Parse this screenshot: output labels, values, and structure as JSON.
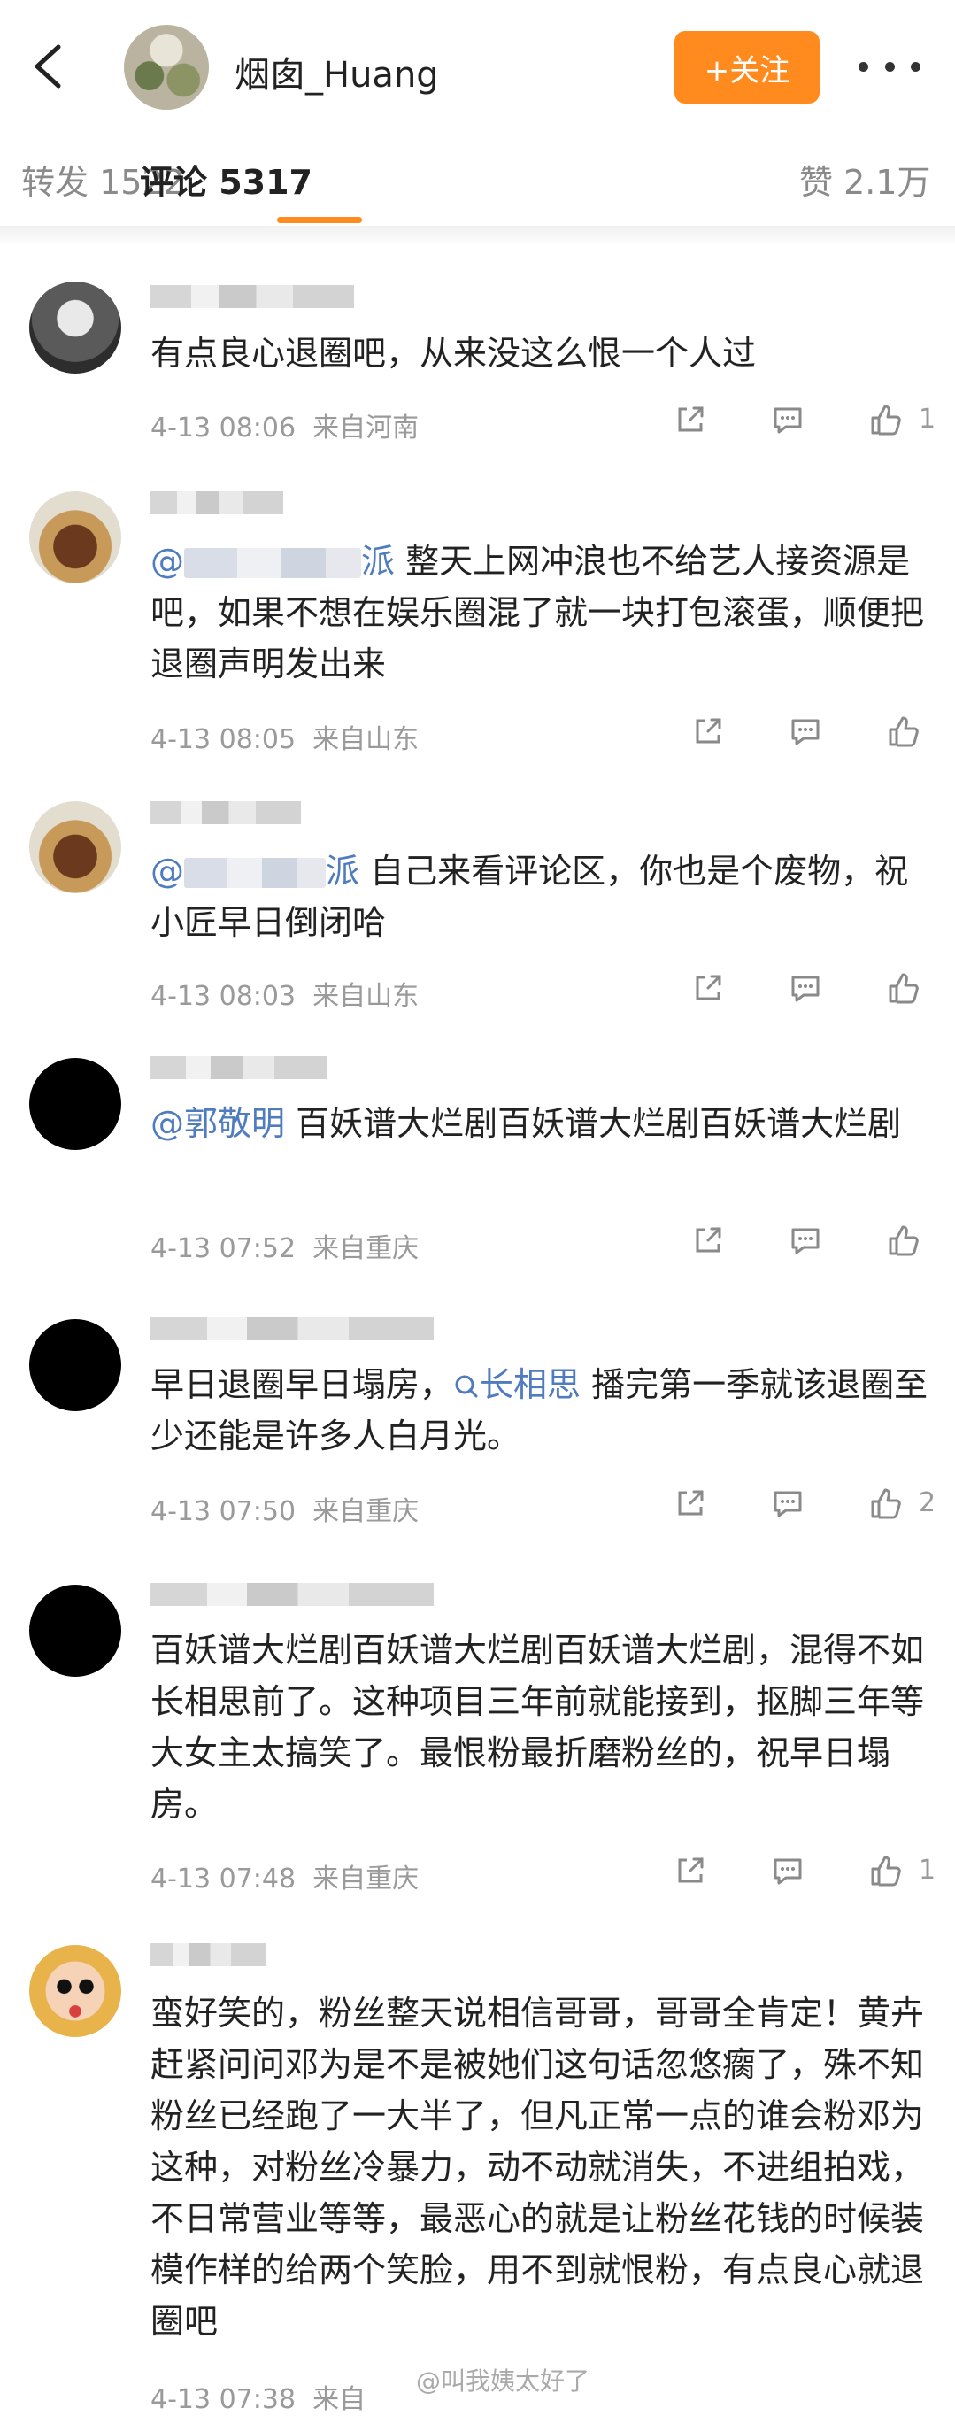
{
  "header": {
    "user_name": "烟囱_Huang",
    "follow_label": "+关注"
  },
  "tabs": {
    "repost": "转发 1522",
    "comments": "评论 5317",
    "likes": "赞 2.1万"
  },
  "comments": [
    {
      "text": "有点良心退圈吧，从来没这么恨一个人过",
      "time": "4-13 08:06",
      "location": "来自河南",
      "likes": "1"
    },
    {
      "mention_suffix": "派",
      "text": "整天上网冲浪也不给艺人接资源是吧，如果不想在娱乐圈混了就一块打包滚蛋，顺便把退圈声明发出来",
      "time": "4-13 08:05",
      "location": "来自山东",
      "likes": ""
    },
    {
      "mention_suffix": "派",
      "text": "自己来看评论区，你也是个废物，祝小匠早日倒闭哈",
      "time": "4-13 08:03",
      "location": "来自山东",
      "likes": ""
    },
    {
      "mention": "@郭敬明",
      "text": "百妖谱大烂剧百妖谱大烂剧百妖谱大烂剧",
      "time": "4-13 07:52",
      "location": "来自重庆",
      "likes": ""
    },
    {
      "text_before": "早日退圈早日塌房，",
      "topic": "长相思",
      "text_after": "播完第一季就该退圈至少还能是许多人白月光。",
      "time": "4-13 07:50",
      "location": "来自重庆",
      "likes": "2"
    },
    {
      "text": "百妖谱大烂剧百妖谱大烂剧百妖谱大烂剧，混得不如长相思前了。这种项目三年前就能接到，抠脚三年等大女主太搞笑了。最恨粉最折磨粉丝的，祝早日塌房。",
      "time": "4-13 07:48",
      "location": "来自重庆",
      "likes": "1"
    },
    {
      "text": "蛮好笑的，粉丝整天说相信哥哥，哥哥全肯定！黄卉赶紧问问邓为是不是被她们这句话忽悠瘸了，殊不知粉丝已经跑了一大半了，但凡正常一点的谁会粉邓为这种，对粉丝冷暴力，动不动就消失，不进组拍戏，不日常营业等等，最恶心的就是让粉丝花钱的时候装模作样的给两个笑脸，用不到就恨粉，有点良心就退圈吧",
      "time": "4-13 07:38",
      "location": "来自",
      "likes": ""
    }
  ],
  "watermark": "@叫我姨太好了",
  "colors": {
    "accent": "#ff8a1e",
    "link": "#4f7bbf",
    "meta": "#9a9a9a"
  }
}
